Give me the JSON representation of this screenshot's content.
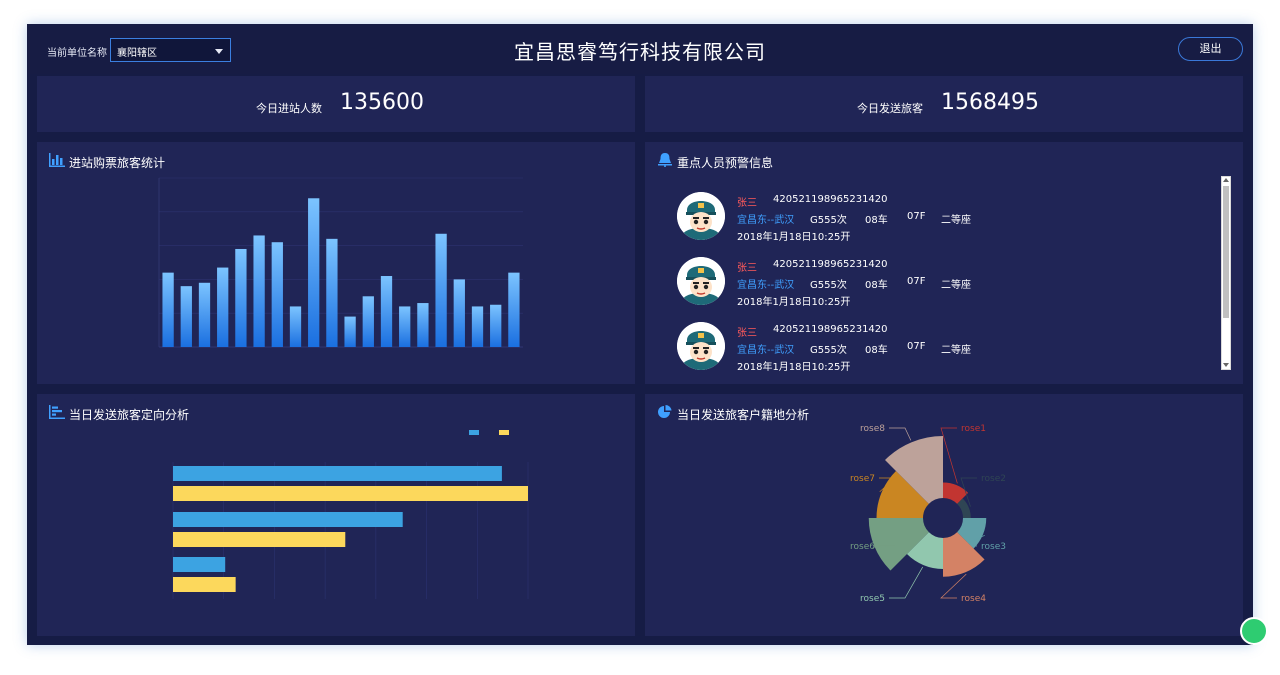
{
  "header": {
    "unit_label": "当前单位名称",
    "unit_selected": "襄阳辖区",
    "title": "宜昌思睿笃行科技有限公司",
    "logout_label": "退出"
  },
  "stats": {
    "entry_label": "今日进站人数",
    "entry_value": "135600",
    "sent_label": "今日发送旅客",
    "sent_value": "1568495"
  },
  "panels": {
    "ticket_title": "进站购票旅客统计",
    "warning_title": "重点人员预警信息",
    "direction_title": "当日发送旅客定向分析",
    "origin_title": "当日发送旅客户籍地分析"
  },
  "warnings": [
    {
      "name": "张三",
      "id": "420521198965231420",
      "route": "宜昌东--武汉",
      "train": "G555次",
      "car": "08车",
      "seat": "07F",
      "class": "二等座",
      "time": "2018年1月18日10:25开"
    },
    {
      "name": "张三",
      "id": "420521198965231420",
      "route": "宜昌东--武汉",
      "train": "G555次",
      "car": "08车",
      "seat": "07F",
      "class": "二等座",
      "time": "2018年1月18日10:25开"
    },
    {
      "name": "张三",
      "id": "420521198965231420",
      "route": "宜昌东--武汉",
      "train": "G555次",
      "car": "08车",
      "seat": "07F",
      "class": "二等座",
      "time": "2018年1月18日10:25开"
    }
  ],
  "colors": {
    "background": "#161c45",
    "panel": "#202556",
    "bar_blue": "#2f8ff0",
    "hbar_blue": "#3ca3e2",
    "hbar_yellow": "#fcd85c",
    "warn_name": "#ff5a5a",
    "warn_route": "#3fa0ff"
  },
  "icons": {
    "ticket": "bar-chart-icon",
    "warning": "bell-icon",
    "direction": "horizontal-bar-icon",
    "origin": "pie-icon",
    "select": "chevron-down-icon"
  },
  "chart_data": [
    {
      "type": "bar",
      "title": "进站购票旅客统计",
      "values": [
        2200,
        1800,
        1900,
        2350,
        2900,
        3300,
        3100,
        1200,
        4400,
        3200,
        900,
        1500,
        2100,
        1200,
        1300,
        3350,
        2000,
        1200,
        1250,
        2200
      ],
      "ylim": [
        0,
        5000
      ]
    },
    {
      "type": "bar",
      "orientation": "horizontal",
      "title": "当日发送旅客定向分析",
      "series": [
        {
          "color": "#3ca3e2",
          "values": [
            630,
            440,
            100
          ]
        },
        {
          "color": "#fcd85c",
          "values": [
            680,
            330,
            120
          ]
        }
      ],
      "xlim": [
        0,
        680
      ]
    },
    {
      "type": "pie",
      "subtype": "rose",
      "title": "当日发送旅客户籍地分析",
      "categories": [
        "rose1",
        "rose2",
        "rose3",
        "rose4",
        "rose5",
        "rose6",
        "rose7",
        "rose8"
      ],
      "values": [
        10,
        5,
        15,
        25,
        20,
        35,
        30,
        40
      ],
      "colors": [
        "#c23531",
        "#2f4554",
        "#61a0a8",
        "#d48265",
        "#91c7ae",
        "#749f83",
        "#ca8622",
        "#bda29a"
      ]
    }
  ]
}
